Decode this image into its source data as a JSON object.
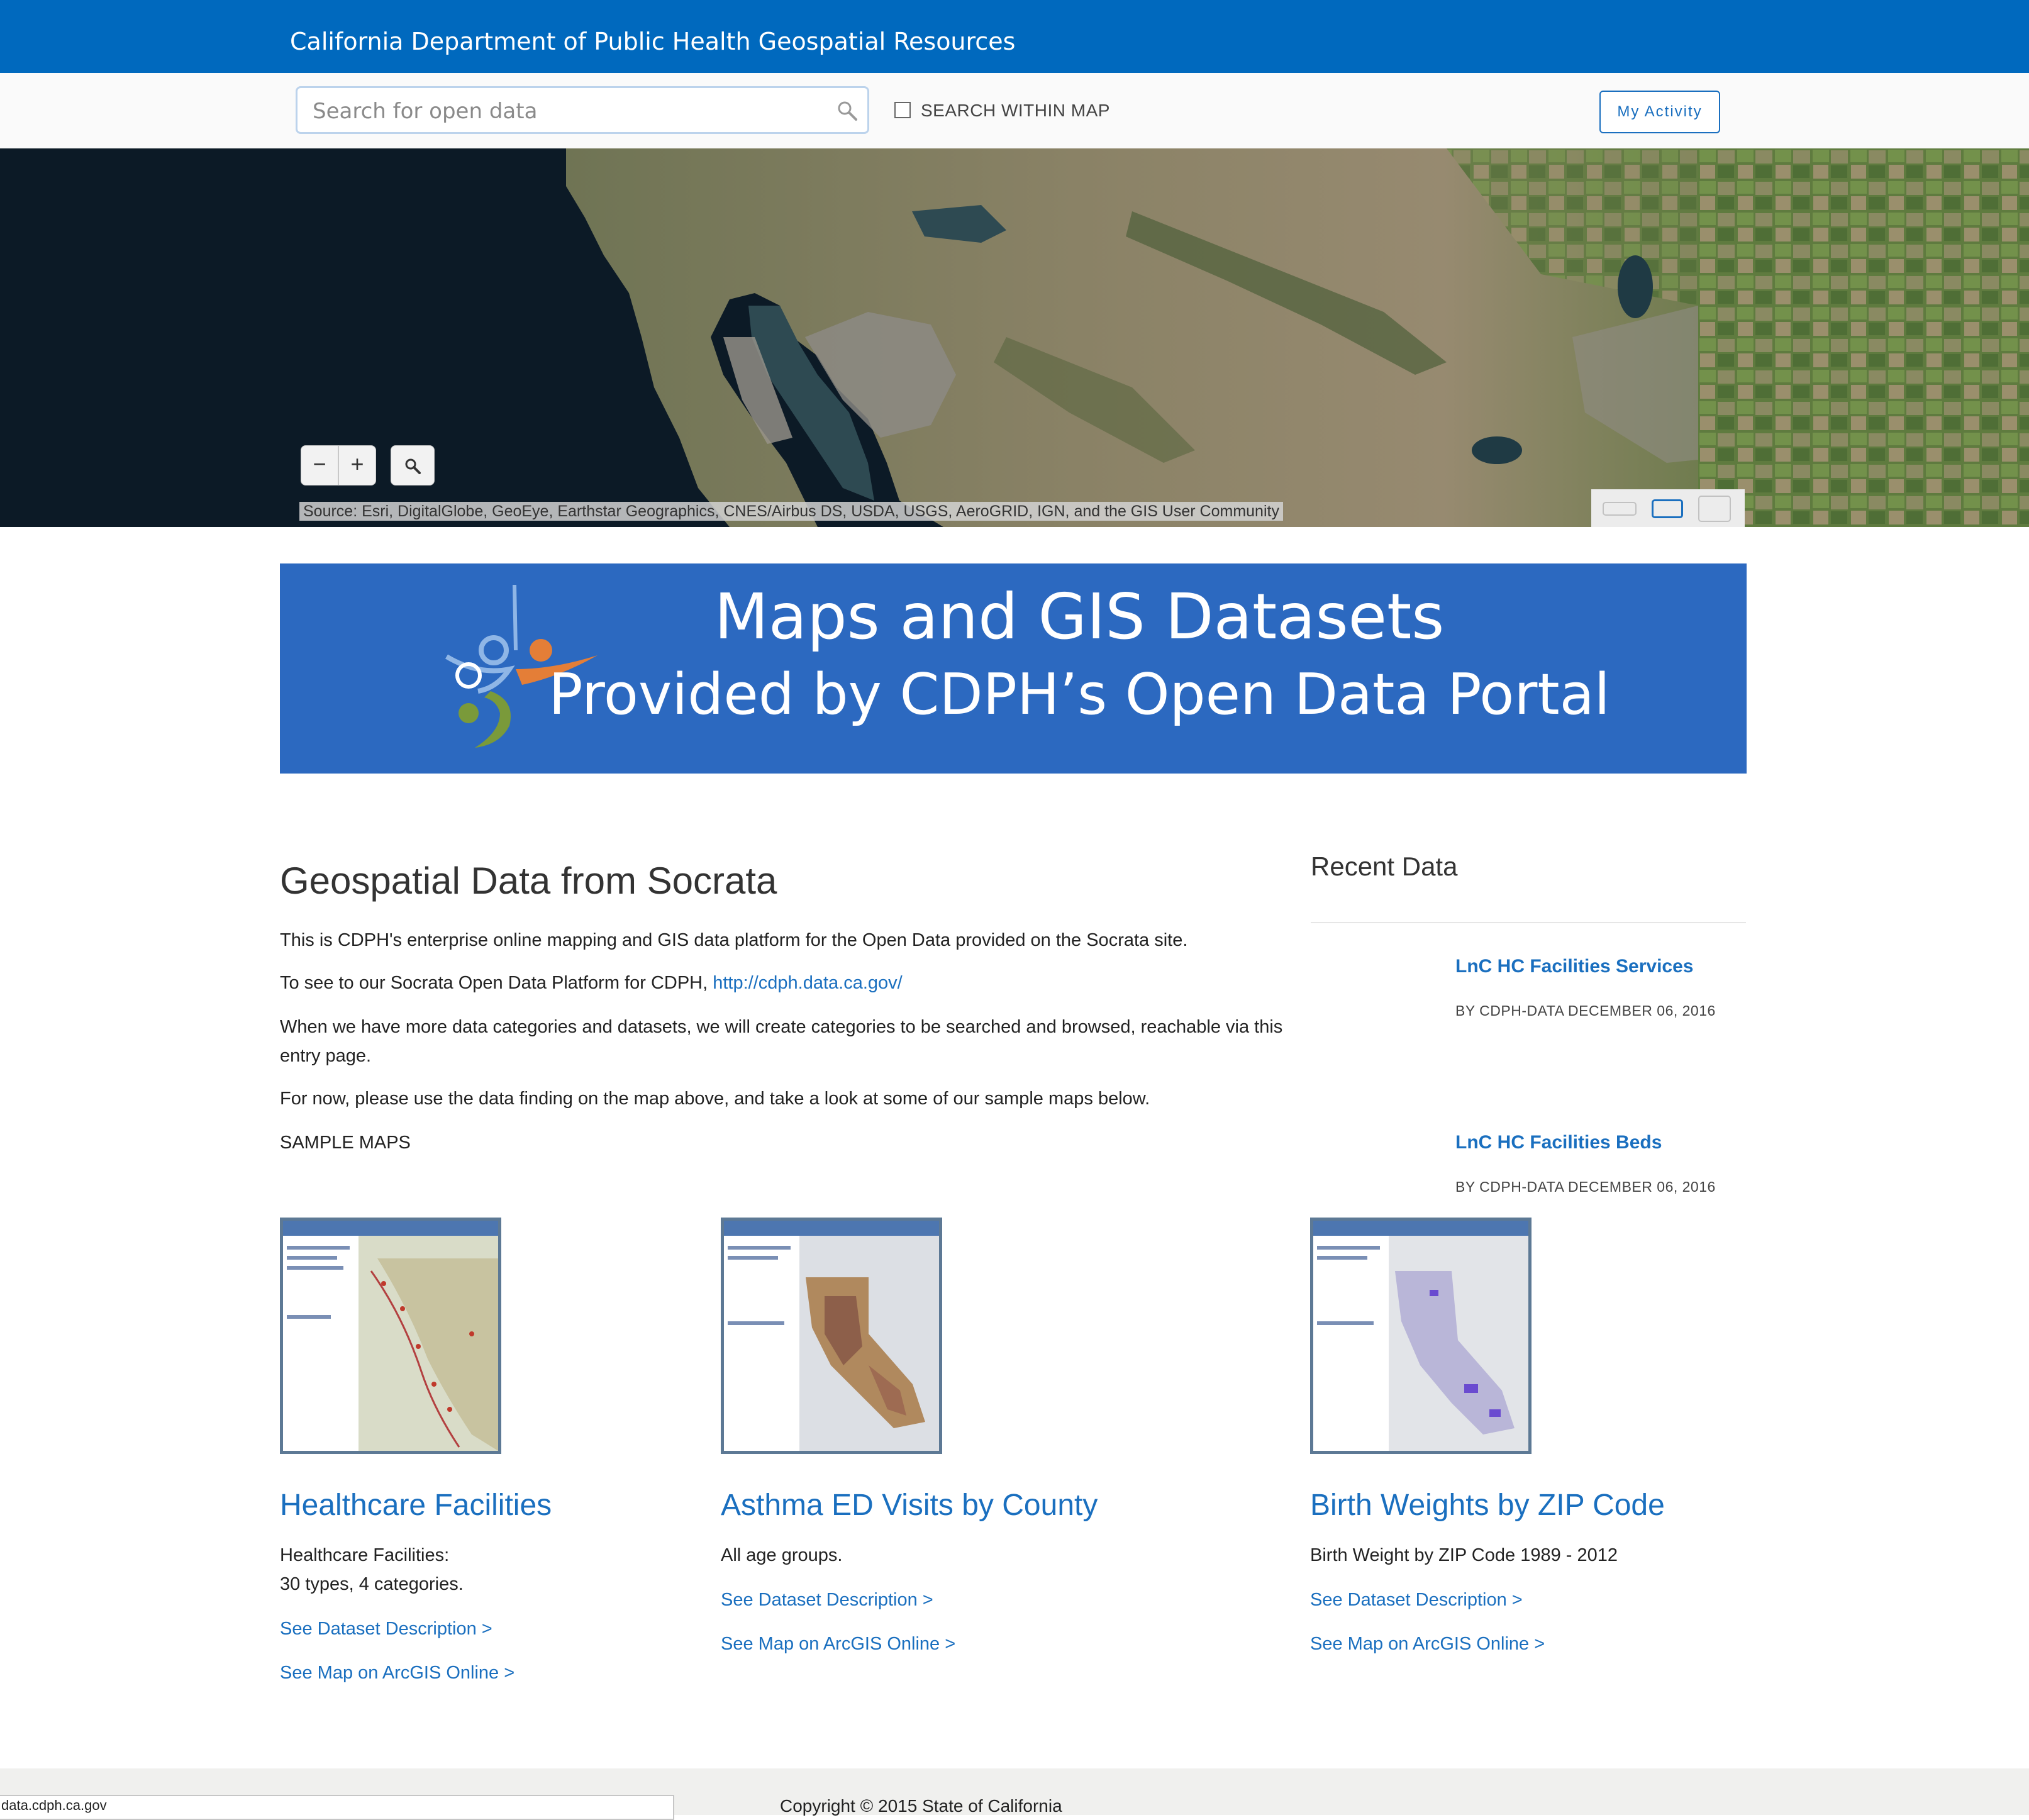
{
  "header": {
    "title": "California Department of Public Health Geospatial Resources"
  },
  "search": {
    "placeholder": "Search for open data",
    "within_map_label": "SEARCH WITHIN MAP",
    "activity_button": "My Activity"
  },
  "map": {
    "zoom_out": "−",
    "zoom_in": "+",
    "attribution": "Source: Esri, DigitalGlobe, GeoEye, Earthstar Geographics, CNES/Airbus DS, USDA, USGS, AeroGRID, IGN, and the GIS User Community"
  },
  "banner": {
    "line1": "Maps and GIS Datasets",
    "line2": "Provided by CDPH’s Open Data Portal"
  },
  "main": {
    "heading": "Geospatial Data from Socrata",
    "p1": "This is CDPH's enterprise online mapping and GIS data platform for the Open Data provided on the Socrata site.",
    "p2_text": "To see to our Socrata Open Data Platform for CDPH, ",
    "p2_link": "http://cdph.data.ca.gov/",
    "p3": "When we have more data categories and datasets, we will create categories to be searched and browsed, reachable via this entry page.",
    "p4": "For now, please use the data finding on the map above, and take a look at some of our sample maps below.",
    "sample_label": "SAMPLE MAPS"
  },
  "recent": {
    "title": "Recent Data",
    "items": [
      {
        "title": "LnC HC Facilities Services",
        "meta": "BY CDPH-DATA DECEMBER 06, 2016"
      },
      {
        "title": "LnC HC Facilities Beds",
        "meta": "BY CDPH-DATA DECEMBER 06, 2016"
      }
    ]
  },
  "cards": [
    {
      "title": "Healthcare Facilities",
      "desc1": "Healthcare Facilities:",
      "desc2": "30 types, 4 categories.",
      "link1": "See Dataset Description >",
      "link2": "See Map on ArcGIS Online >"
    },
    {
      "title": "Asthma ED Visits by County",
      "desc1": "All age groups.",
      "link1": "See Dataset Description >",
      "link2": "See Map on ArcGIS Online >"
    },
    {
      "title": "Birth Weights by ZIP Code",
      "desc1": "Birth Weight by ZIP Code 1989 - 2012",
      "link1": "See Dataset Description >",
      "link2": "See Map on ArcGIS Online >"
    }
  ],
  "footer": {
    "status_url": "data.cdph.ca.gov",
    "copyright": "Copyright © 2015 State of California"
  },
  "colors": {
    "header_blue": "#0069be",
    "banner_blue": "#2c69c0",
    "link_blue": "#1a6fbf"
  },
  "icons": [
    "search-icon",
    "magnifier-icon",
    "cdph-logo",
    "basemap-icons"
  ]
}
